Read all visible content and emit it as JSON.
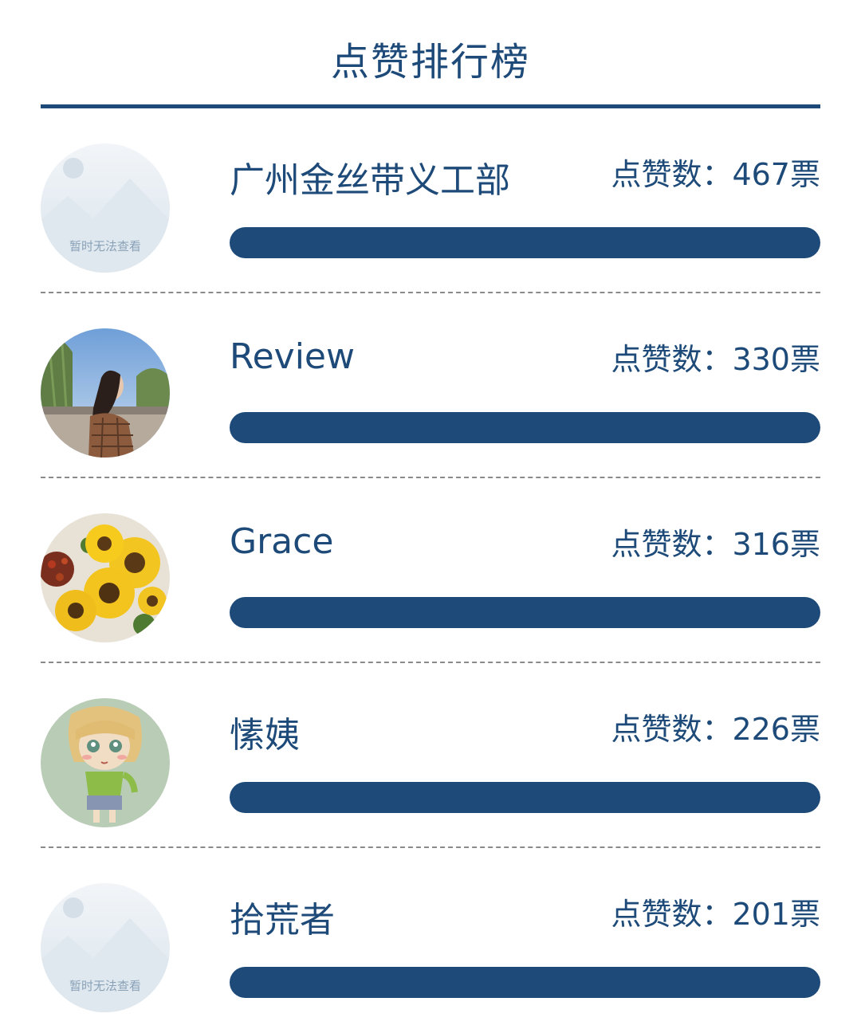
{
  "title": "点赞排行榜",
  "accent_color": "#1d4a78",
  "vote_prefix": "点赞数：",
  "vote_suffix": "票",
  "entries": [
    {
      "name": "广州金丝带义工部",
      "votes": "467",
      "bar_fill": 1.0,
      "avatar": "placeholder-avatar",
      "avatar_text": "暂时无法查看"
    },
    {
      "name": "Review",
      "votes": "330",
      "bar_fill": 1.0,
      "avatar": "girl-outdoor-avatar"
    },
    {
      "name": "Grace",
      "votes": "316",
      "bar_fill": 1.0,
      "avatar": "sunflower-avatar"
    },
    {
      "name": "愫姨",
      "votes": "226",
      "bar_fill": 1.0,
      "avatar": "cartoon-drawing-avatar"
    },
    {
      "name": "拾荒者",
      "votes": "201",
      "bar_fill": 1.0,
      "avatar": "placeholder-avatar",
      "avatar_text": "暂时无法查看"
    }
  ]
}
